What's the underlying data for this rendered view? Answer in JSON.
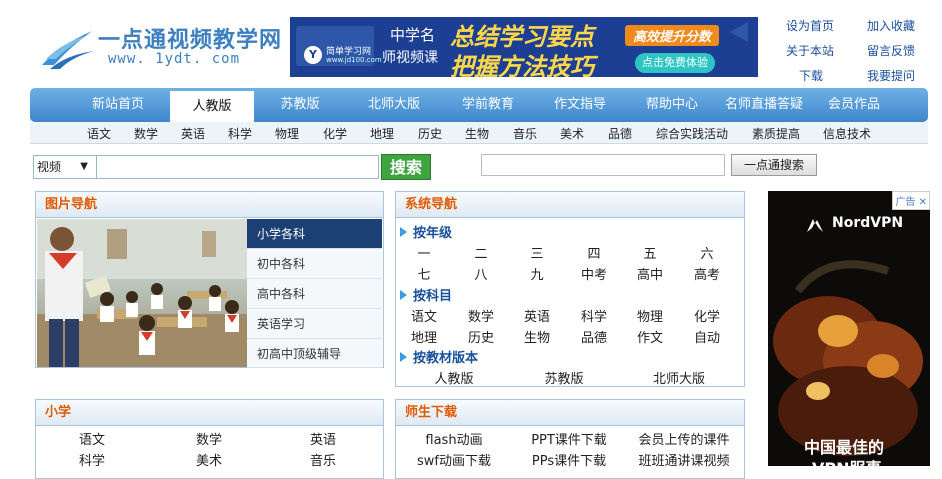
{
  "header": {
    "logo_title": "一点通视频教学网",
    "logo_url": "www. 1ydt. com",
    "links": [
      "设为首页",
      "加入收藏",
      "关于本站",
      "留言反馈",
      "下载",
      "我要提问"
    ]
  },
  "banner": {
    "brand_small": "简单学习网",
    "brand_url": "www.jd100.com",
    "line1": "中学名",
    "line2": "师视频课",
    "big1": "总结学习要点",
    "big2": "把握方法技巧",
    "tag": "高效提升分数",
    "button": "点击免费体验"
  },
  "nav": {
    "items": [
      "新站首页",
      "人教版",
      "苏教版",
      "北师大版",
      "学前教育",
      "作文指导",
      "帮助中心",
      "名师直播答疑",
      "会员作品"
    ],
    "active": "人教版"
  },
  "subjects": [
    "语文",
    "数学",
    "英语",
    "科学",
    "物理",
    "化学",
    "地理",
    "历史",
    "生物",
    "音乐",
    "美术",
    "品德",
    "综合实践活动",
    "素质提高",
    "信息技术"
  ],
  "search": {
    "select_value": "视频",
    "button": "搜索",
    "site_button": "一点通搜索"
  },
  "photo_nav": {
    "title": "图片导航",
    "tabs": [
      "小学各科",
      "初中各科",
      "高中各科",
      "英语学习",
      "初高中顶级辅导"
    ]
  },
  "system_nav": {
    "title": "系统导航",
    "grade_head": "按年级",
    "grades": [
      "一",
      "二",
      "三",
      "四",
      "五",
      "六",
      "七",
      "八",
      "九",
      "中考",
      "高中",
      "高考"
    ],
    "subject_head": "按科目",
    "subjects": [
      "语文",
      "数学",
      "英语",
      "科学",
      "物理",
      "化学",
      "地理",
      "历史",
      "生物",
      "品德",
      "作文",
      "自动"
    ],
    "edition_head": "按教材版本",
    "editions": [
      "人教版",
      "苏教版",
      "北师大版"
    ]
  },
  "primary": {
    "title": "小学",
    "items": [
      "语文",
      "数学",
      "英语",
      "科学",
      "美术",
      "音乐"
    ]
  },
  "downloads": {
    "title": "师生下载",
    "items": [
      "flash动画",
      "PPT课件下载",
      "会员上传的课件",
      "swf动画下载",
      "PPs课件下载",
      "班班通讲课视频"
    ]
  },
  "ad": {
    "badge": "广告",
    "brand": "NordVPN",
    "text1": "中国最佳的",
    "text2": "VPN服事"
  },
  "colors": {
    "nav_blue": "#3e86cc",
    "panel_title": "#e05a00",
    "link_blue": "#1a4f9c",
    "search_green": "#3fa33f"
  }
}
